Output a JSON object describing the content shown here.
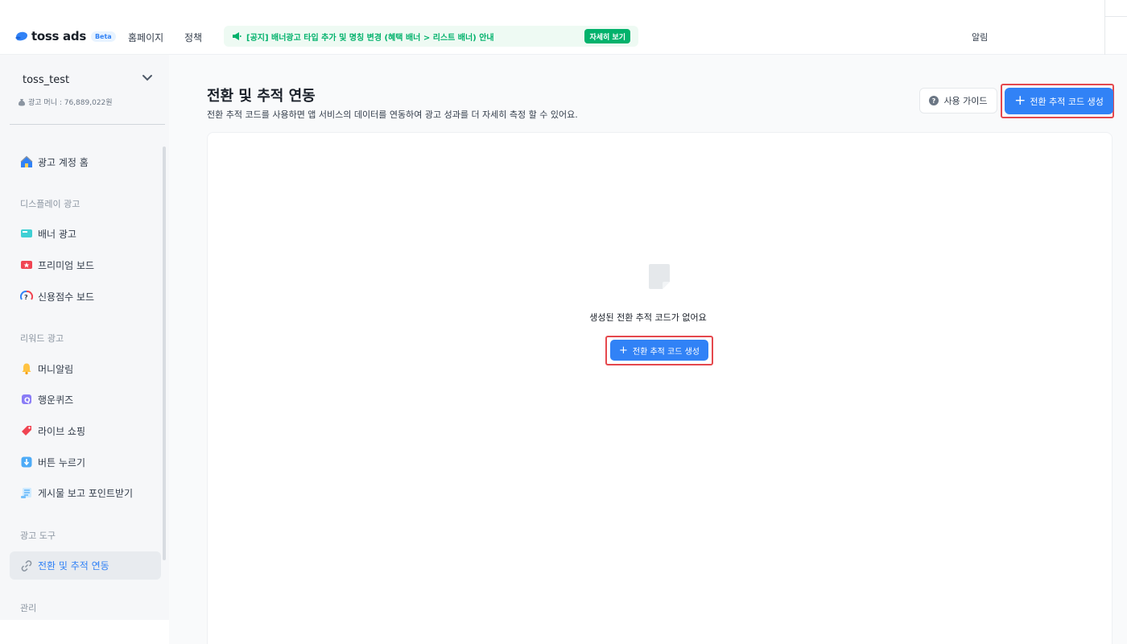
{
  "header": {
    "logo_text": "toss ads",
    "beta": "Beta",
    "nav": [
      "홈페이지",
      "정책"
    ],
    "notice_text": "[공지] 배너광고 타입 추가 및 명칭 변경 (혜택 배너 > 리스트 배너) 안내",
    "notice_button": "자세히 보기",
    "alarm": "알림"
  },
  "sidebar": {
    "account_name": "toss_test",
    "ad_money": "광고 머니 : 76,889,022원",
    "home": "광고 계정 홈",
    "groups": {
      "display": "디스플레이 광고",
      "reward": "리워드 광고",
      "tools": "광고 도구",
      "manage": "관리"
    },
    "items": {
      "banner": "배너 광고",
      "premium": "프리미엄 보드",
      "credit": "신용점수 보드",
      "money_alarm": "머니알림",
      "quiz": "행운퀴즈",
      "live": "라이브 쇼핑",
      "button": "버튼 누르기",
      "post": "게시물 보고 포인트받기",
      "conversion": "전환 및 추적 연동"
    }
  },
  "main": {
    "title": "전환 및 추적 연동",
    "description": "전환 추적 코드를 사용하면 앱 서비스의 데이터를 연동하여 광고 성과를 더 자세히 측정 할 수 있어요.",
    "guide_button": "사용 가이드",
    "create_button": "전환 추적 코드 생성",
    "empty_text": "생성된 전환 추적 코드가 없어요",
    "empty_create_button": "전환 추적 코드 생성"
  },
  "colors": {
    "primary": "#3182f6",
    "notice_green": "#03b26c",
    "highlight_red": "#e5484d",
    "sidebar_bg": "#f6f7f9"
  }
}
